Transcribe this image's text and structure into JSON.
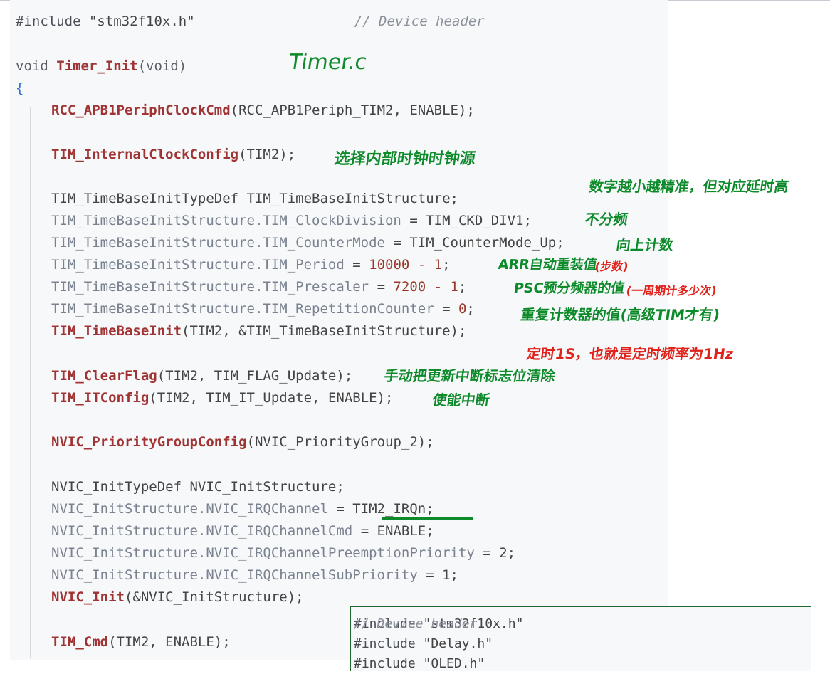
{
  "code": {
    "include_kw": "#include",
    "include_file": "\"stm32f10x.h\"",
    "include_comment": "// Device header",
    "void1": "void",
    "func_name": "Timer_Init",
    "func_params": "(void)",
    "open_brace": "{",
    "rcc_fn": "RCC_APB1PeriphClockCmd",
    "rcc_args": "(RCC_APB1Periph_TIM2, ENABLE);",
    "clk_fn": "TIM_InternalClockConfig",
    "clk_args": "(TIM2);",
    "tb_decl": "TIM_TimeBaseInitTypeDef TIM_TimeBaseInitStructure;",
    "tb_div_lhs": "TIM_TimeBaseInitStructure.TIM_ClockDivision",
    "tb_div_rhs": " = TIM_CKD_DIV1;",
    "tb_mode_lhs": "TIM_TimeBaseInitStructure.TIM_CounterMode",
    "tb_mode_rhs": " = TIM_CounterMode_Up;",
    "tb_per_lhs": "TIM_TimeBaseInitStructure.TIM_Period",
    "tb_per_eq": " = ",
    "tb_per_val": "10000 - 1",
    "semi": ";",
    "tb_psc_lhs": "TIM_TimeBaseInitStructure.TIM_Prescaler",
    "tb_psc_val": "7200 - 1",
    "tb_rep_lhs": "TIM_TimeBaseInitStructure.TIM_RepetitionCounter",
    "tb_rep_val": "0",
    "tb_init_fn": "TIM_TimeBaseInit",
    "tb_init_args": "(TIM2, &TIM_TimeBaseInitStructure);",
    "clr_fn": "TIM_ClearFlag",
    "clr_args": "(TIM2, TIM_FLAG_Update);",
    "it_fn": "TIM_ITConfig",
    "it_args": "(TIM2, TIM_IT_Update, ENABLE);",
    "nvic_grp_fn": "NVIC_PriorityGroupConfig",
    "nvic_grp_args": "(NVIC_PriorityGroup_2);",
    "nvic_decl": "NVIC_InitTypeDef NVIC_InitStructure;",
    "nvic_ch_lhs": "NVIC_InitStructure.NVIC_IRQChannel",
    "nvic_ch_rhs": " = TIM2_IRQn;",
    "nvic_cmd_lhs": "NVIC_InitStructure.NVIC_IRQChannelCmd",
    "nvic_cmd_rhs": " = ENABLE;",
    "nvic_pre_lhs": "NVIC_InitStructure.NVIC_IRQChannelPreemptionPriority",
    "nvic_pre_rhs": " = 2;",
    "nvic_sub_lhs": "NVIC_InitStructure.NVIC_IRQChannelSubPriority",
    "nvic_sub_rhs": " = 1;",
    "nvic_init_fn": "NVIC_Init",
    "nvic_init_args": "(&NVIC_InitStructure);",
    "cmd_fn": "TIM_Cmd",
    "cmd_args": "(TIM2, ENABLE);"
  },
  "annotations": {
    "file_label": "Timer.c",
    "clock_source": "选择内部时钟时钟源",
    "accuracy_note": "数字越小越精准，但对应延时高",
    "no_division": "不分频",
    "count_up": "向上计数",
    "arr_note": "ARR自动重装值",
    "arr_paren": "(步数)",
    "psc_note": "PSC预分频器的值",
    "psc_paren": "(一周期计多少次)",
    "rep_note": "重复计数器的值(高级TIM才有)",
    "timing_note": "定时1S，也就是定时频率为1Hz",
    "clear_flag_note": "手动把更新中断标志位清除",
    "enable_it_note": "使能中断"
  },
  "inset": {
    "line1_kw": "#include",
    "line1_file": "\"stm32f10x.h\"",
    "line1_comment": "// Device header",
    "line2_kw": "#include",
    "line2_file": "\"Delay.h\"",
    "line3_partial": "#include \"OLED.h\""
  },
  "colors": {
    "annotation_green": "#0d8a2a",
    "annotation_red": "#e0221b",
    "function_name": "#a03434",
    "member_access": "#7a8290",
    "brace": "#2f6fd1"
  }
}
